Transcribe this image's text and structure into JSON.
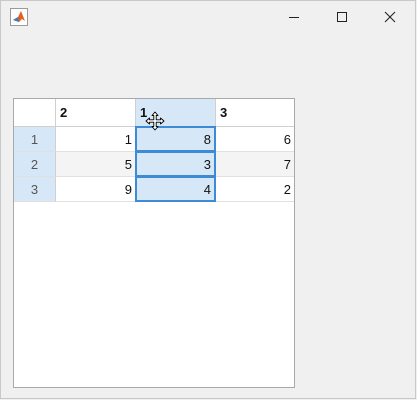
{
  "window": {
    "icon": "matlab-logo-icon",
    "controls": [
      "minimize-icon",
      "maximize-icon",
      "close-icon"
    ]
  },
  "table": {
    "columns": [
      "2",
      "1",
      "3"
    ],
    "rows": [
      {
        "label": "1",
        "values": [
          "1",
          "8",
          "6"
        ]
      },
      {
        "label": "2",
        "values": [
          "5",
          "3",
          "7"
        ]
      },
      {
        "label": "3",
        "values": [
          "9",
          "4",
          "2"
        ]
      }
    ],
    "selected_column_index": 1
  },
  "colors": {
    "selection_fill": "#d6e8f7",
    "selection_border": "#3d8bd5",
    "background": "#f0f0f0"
  },
  "cursor": "move-cursor-icon"
}
